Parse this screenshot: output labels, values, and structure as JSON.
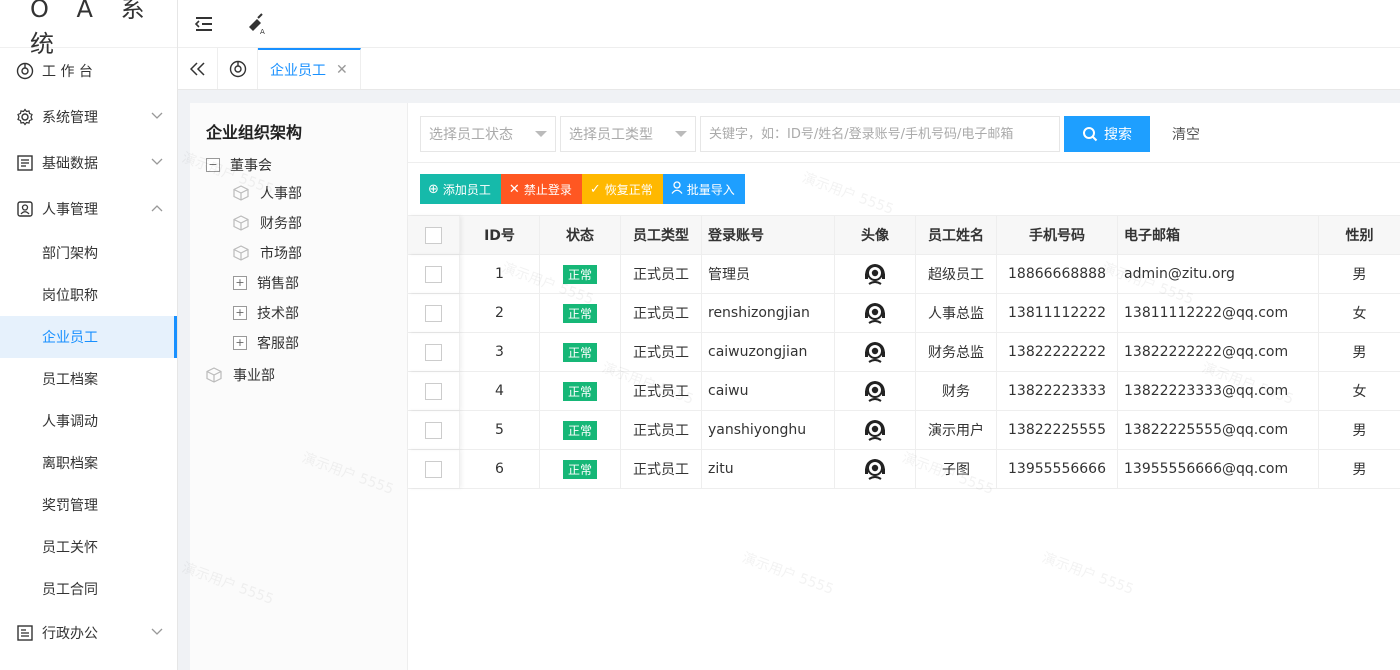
{
  "app": {
    "title": "O A 系 统"
  },
  "sidebar": {
    "items": [
      {
        "label": "工 作 台",
        "icon": "dashboard-icon"
      },
      {
        "label": "系统管理",
        "icon": "gear-icon"
      },
      {
        "label": "基础数据",
        "icon": "data-icon"
      },
      {
        "label": "人事管理",
        "icon": "person-icon"
      },
      {
        "label": "行政办公",
        "icon": "office-icon"
      }
    ],
    "sub": [
      "部门架构",
      "岗位职称",
      "企业员工",
      "员工档案",
      "人事调动",
      "离职档案",
      "奖罚管理",
      "员工关怀",
      "员工合同"
    ]
  },
  "tabs": [
    {
      "label": "企业员工"
    }
  ],
  "org": {
    "title": "企业组织架构",
    "nodes": [
      "董事会",
      "人事部",
      "财务部",
      "市场部",
      "销售部",
      "技术部",
      "客服部",
      "事业部"
    ]
  },
  "filters": {
    "status_placeholder": "选择员工状态",
    "type_placeholder": "选择员工类型",
    "keyword_placeholder": "关键字，如：ID号/姓名/登录账号/手机号码/电子邮箱",
    "search_label": "搜索",
    "clear_label": "清空"
  },
  "actions": {
    "add": "添加员工",
    "ban": "禁止登录",
    "restore": "恢复正常",
    "import": "批量导入"
  },
  "colors": {
    "primary": "#1e9fff",
    "add": "#16baaa",
    "ban": "#ff5722",
    "restore": "#ffb800",
    "import": "#1e9fff",
    "status_ok": "#16b777"
  },
  "table": {
    "headers": [
      "ID号",
      "状态",
      "员工类型",
      "登录账号",
      "头像",
      "员工姓名",
      "手机号码",
      "电子邮箱",
      "性别"
    ],
    "rows": [
      {
        "id": "1",
        "status": "正常",
        "type": "正式员工",
        "account": "管理员",
        "name": "超级员工",
        "phone": "18866668888",
        "email": "admin@zitu.org",
        "sex": "男"
      },
      {
        "id": "2",
        "status": "正常",
        "type": "正式员工",
        "account": "renshizongjian",
        "name": "人事总监",
        "phone": "13811112222",
        "email": "13811112222@qq.com",
        "sex": "女"
      },
      {
        "id": "3",
        "status": "正常",
        "type": "正式员工",
        "account": "caiwuzongjian",
        "name": "财务总监",
        "phone": "13822222222",
        "email": "13822222222@qq.com",
        "sex": "男"
      },
      {
        "id": "4",
        "status": "正常",
        "type": "正式员工",
        "account": "caiwu",
        "name": "财务",
        "phone": "13822223333",
        "email": "13822223333@qq.com",
        "sex": "女"
      },
      {
        "id": "5",
        "status": "正常",
        "type": "正式员工",
        "account": "yanshiyonghu",
        "name": "演示用户",
        "phone": "13822225555",
        "email": "13822225555@qq.com",
        "sex": "男"
      },
      {
        "id": "6",
        "status": "正常",
        "type": "正式员工",
        "account": "zitu",
        "name": "子图",
        "phone": "13955556666",
        "email": "13955556666@qq.com",
        "sex": "男"
      }
    ]
  }
}
